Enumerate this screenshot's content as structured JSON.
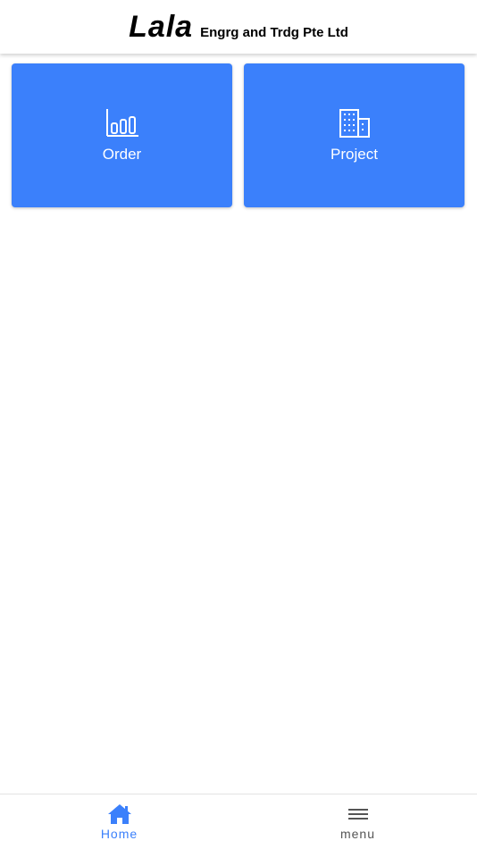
{
  "header": {
    "brand_name": "Lala",
    "brand_sub": "Engrg and Trdg Pte Ltd"
  },
  "tiles": [
    {
      "label": "Order",
      "icon": "bar-chart-icon"
    },
    {
      "label": "Project",
      "icon": "building-icon"
    }
  ],
  "bottom_nav": {
    "items": [
      {
        "label": "Home",
        "icon": "home-icon",
        "active": true
      },
      {
        "label": "menu",
        "icon": "hamburger-menu-icon",
        "active": false
      }
    ]
  },
  "colors": {
    "accent": "#3b80fb",
    "nav_inactive": "#555555",
    "background": "#ffffff"
  }
}
